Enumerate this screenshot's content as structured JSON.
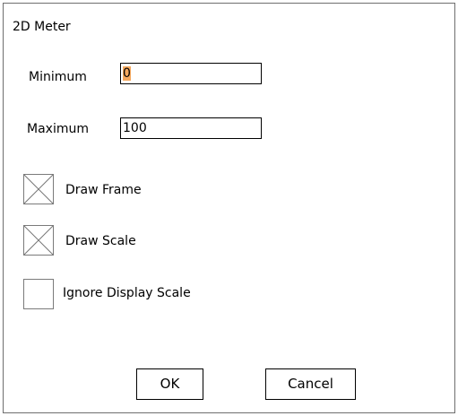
{
  "dialog": {
    "title": "2D Meter"
  },
  "fields": {
    "minimum": {
      "label": "Minimum",
      "value": "0"
    },
    "maximum": {
      "label": "Maximum",
      "value": "100"
    }
  },
  "options": [
    {
      "label": "Draw Frame",
      "checked": true,
      "icon": "checkbox-checked-icon"
    },
    {
      "label": "Draw Scale",
      "checked": true,
      "icon": "checkbox-checked-icon"
    },
    {
      "label": "Ignore Display Scale",
      "checked": false,
      "icon": "checkbox-empty-icon"
    }
  ],
  "buttons": {
    "ok": "OK",
    "cancel": "Cancel"
  },
  "colors": {
    "selection": "#f4a85e",
    "border": "#6e6e6e"
  }
}
